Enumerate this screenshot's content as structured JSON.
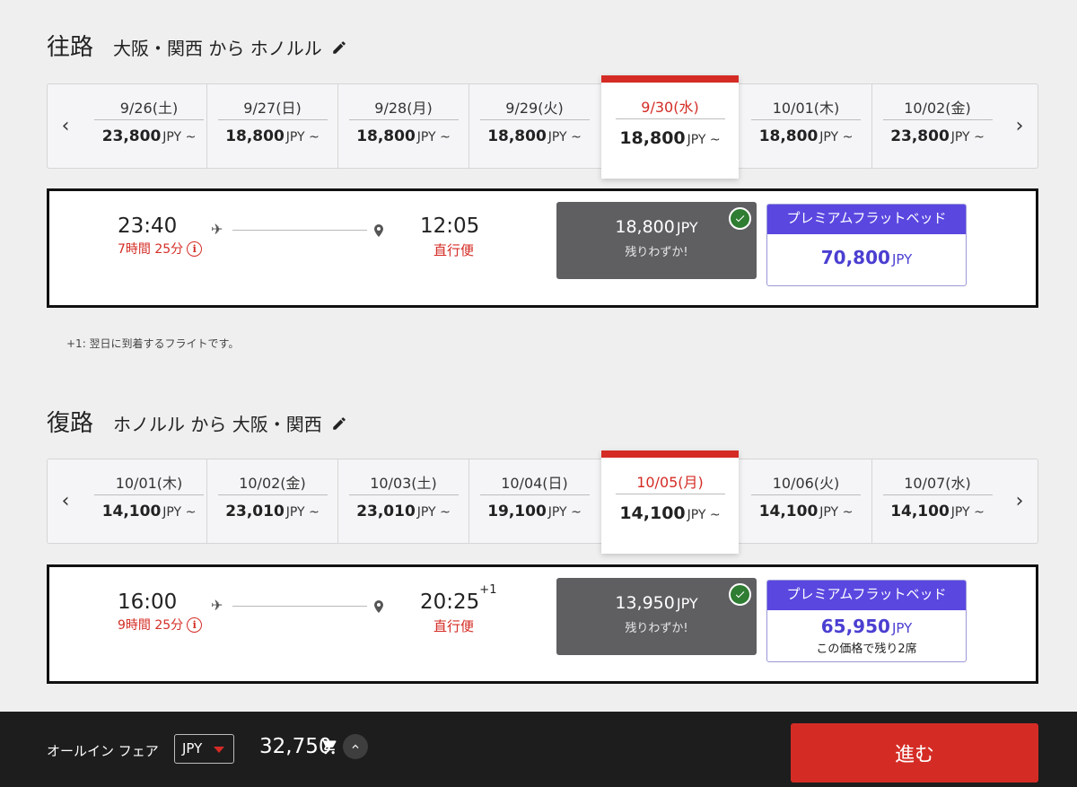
{
  "outbound": {
    "heading": "往路",
    "route": "大阪・関西 から ホノルル",
    "dates": [
      {
        "date": "9/26(土)",
        "price": "23,800",
        "unit": "JPY ~"
      },
      {
        "date": "9/27(日)",
        "price": "18,800",
        "unit": "JPY ~"
      },
      {
        "date": "9/28(月)",
        "price": "18,800",
        "unit": "JPY ~"
      },
      {
        "date": "9/29(火)",
        "price": "18,800",
        "unit": "JPY ~"
      },
      {
        "date": "9/30(水)",
        "price": "18,800",
        "unit": "JPY ~"
      },
      {
        "date": "10/01(木)",
        "price": "18,800",
        "unit": "JPY ~"
      },
      {
        "date": "10/02(金)",
        "price": "23,800",
        "unit": "JPY ~"
      }
    ],
    "selected_index": 4,
    "flight": {
      "depart": "23:40",
      "duration": "7時間 25分",
      "arrive": "12:05",
      "arrive_plus": "",
      "type": "直行便",
      "std_price": "18,800",
      "std_unit": "JPY",
      "std_note": "残りわずか!",
      "prem_label": "プレミアムフラットベッド",
      "prem_price": "70,800",
      "prem_unit": "JPY",
      "prem_note": ""
    }
  },
  "footnote": "+1: 翌日に到着するフライトです。",
  "inbound": {
    "heading": "復路",
    "route": "ホノルル から 大阪・関西",
    "dates": [
      {
        "date": "10/01(木)",
        "price": "14,100",
        "unit": "JPY ~"
      },
      {
        "date": "10/02(金)",
        "price": "23,010",
        "unit": "JPY ~"
      },
      {
        "date": "10/03(土)",
        "price": "23,010",
        "unit": "JPY ~"
      },
      {
        "date": "10/04(日)",
        "price": "19,100",
        "unit": "JPY ~"
      },
      {
        "date": "10/05(月)",
        "price": "14,100",
        "unit": "JPY ~"
      },
      {
        "date": "10/06(火)",
        "price": "14,100",
        "unit": "JPY ~"
      },
      {
        "date": "10/07(水)",
        "price": "14,100",
        "unit": "JPY ~"
      }
    ],
    "selected_index": 4,
    "flight": {
      "depart": "16:00",
      "duration": "9時間 25分",
      "arrive": "20:25",
      "arrive_plus": "+1",
      "type": "直行便",
      "std_price": "13,950",
      "std_unit": "JPY",
      "std_note": "残りわずか!",
      "prem_label": "プレミアムフラットベッド",
      "prem_price": "65,950",
      "prem_unit": "JPY",
      "prem_note": "この価格で残り2席"
    }
  },
  "bottom": {
    "allin_label": "オールイン フェア",
    "currency": "JPY",
    "total": "32,750",
    "go_label": "進む"
  },
  "colors": {
    "accent_red": "#d42c25",
    "premium_purple": "#5a47e0",
    "check_green": "#2e7d32"
  }
}
